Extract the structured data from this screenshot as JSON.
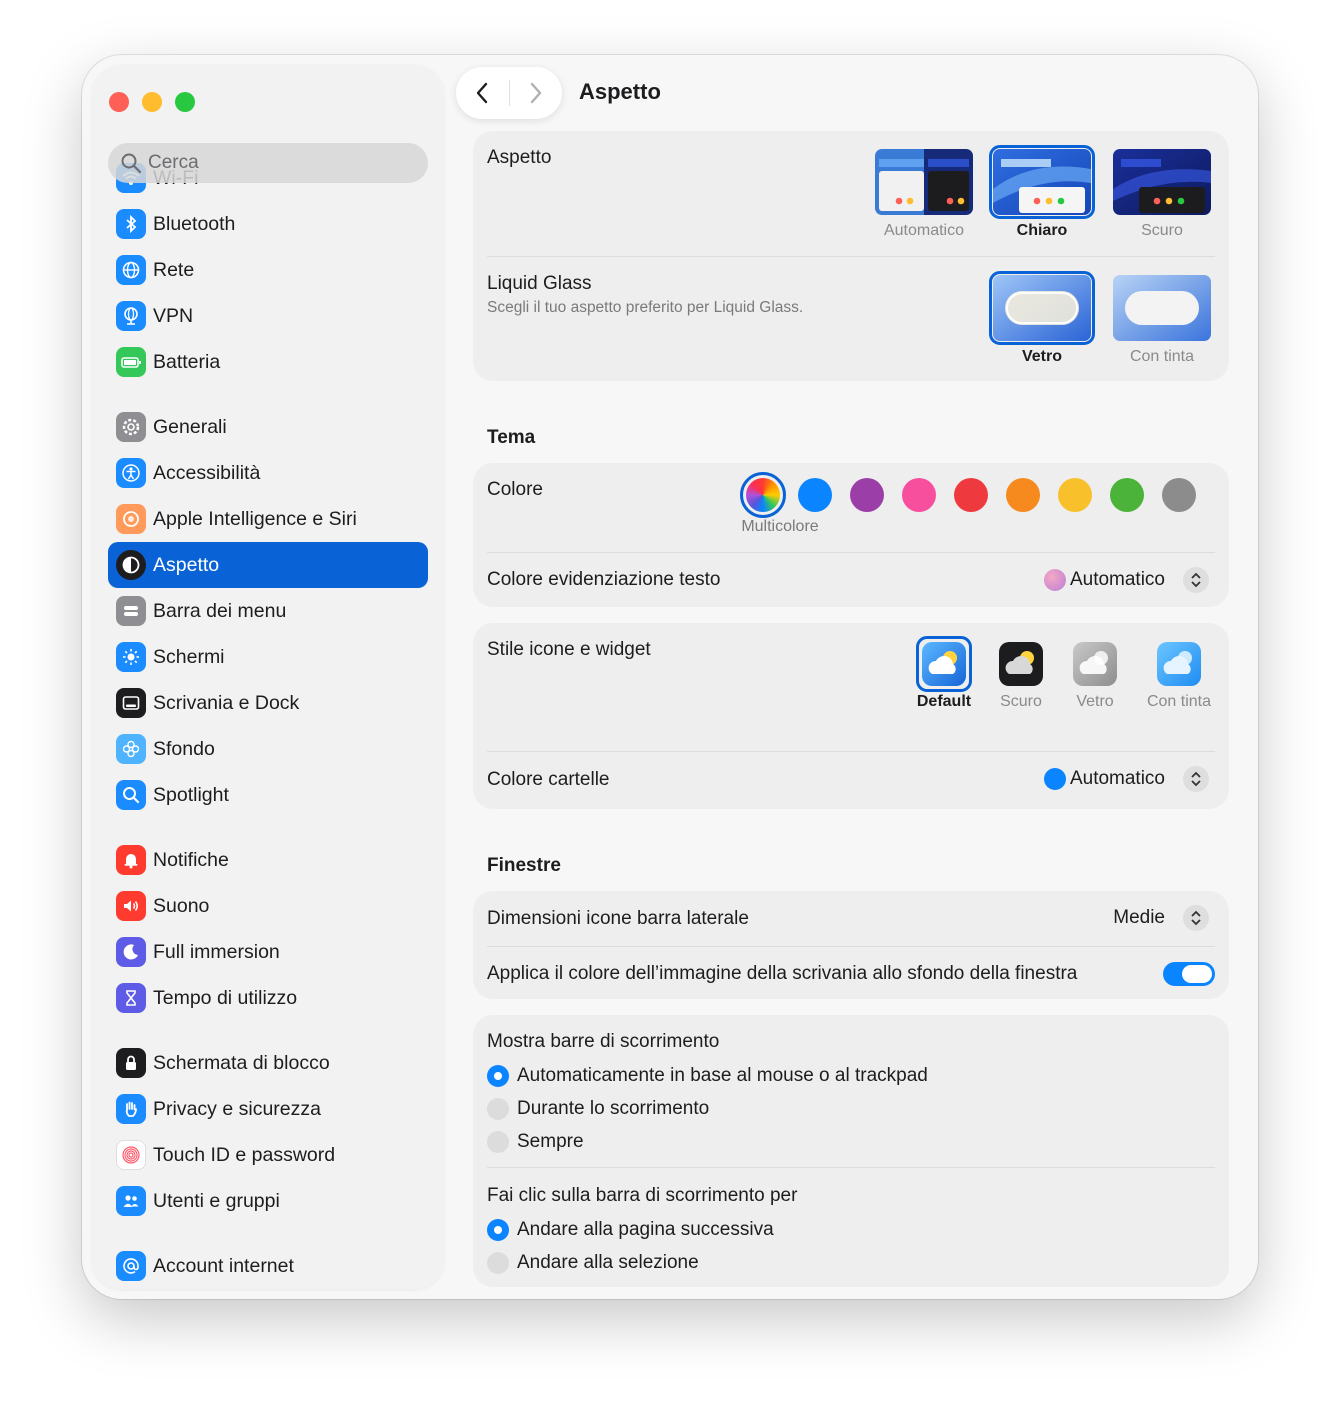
{
  "sidebar": {
    "search_placeholder": "Cerca",
    "groups": [
      [
        {
          "label": "Wi-Fi",
          "icon": "wifi-icon",
          "color": "#1a8cff"
        },
        {
          "label": "Bluetooth",
          "icon": "bluetooth-icon",
          "color": "#1a8cff"
        },
        {
          "label": "Rete",
          "icon": "globe-icon",
          "color": "#1a8cff"
        },
        {
          "label": "VPN",
          "icon": "vpn-globe-icon",
          "color": "#1a8cff"
        },
        {
          "label": "Batteria",
          "icon": "battery-icon",
          "color": "#34c759"
        }
      ],
      [
        {
          "label": "Generali",
          "icon": "gear-icon",
          "color": "#8e8e93"
        },
        {
          "label": "Accessibilità",
          "icon": "accessibility-icon",
          "color": "#1a8cff"
        },
        {
          "label": "Apple Intelligence e Siri",
          "icon": "siri-icon",
          "color": "#ff9a5a"
        },
        {
          "label": "Aspetto",
          "icon": "appearance-icon",
          "color": "#1d1d1f",
          "active": true
        },
        {
          "label": "Barra dei menu",
          "icon": "menubar-icon",
          "color": "#8e8e93"
        },
        {
          "label": "Schermi",
          "icon": "brightness-icon",
          "color": "#1a8cff"
        },
        {
          "label": "Scrivania e Dock",
          "icon": "dock-icon",
          "color": "#1d1d1f"
        },
        {
          "label": "Sfondo",
          "icon": "wallpaper-icon",
          "color": "#4fb3ff"
        },
        {
          "label": "Spotlight",
          "icon": "spotlight-icon",
          "color": "#1a8cff"
        }
      ],
      [
        {
          "label": "Notifiche",
          "icon": "bell-icon",
          "color": "#ff3b30"
        },
        {
          "label": "Suono",
          "icon": "speaker-icon",
          "color": "#ff3b30"
        },
        {
          "label": "Full immersion",
          "icon": "moon-icon",
          "color": "#5e5ce6"
        },
        {
          "label": "Tempo di utilizzo",
          "icon": "hourglass-icon",
          "color": "#5e5ce6"
        }
      ],
      [
        {
          "label": "Schermata di blocco",
          "icon": "lock-icon",
          "color": "#1d1d1f"
        },
        {
          "label": "Privacy e sicurezza",
          "icon": "hand-icon",
          "color": "#1a8cff"
        },
        {
          "label": "Touch ID e password",
          "icon": "fingerprint-icon",
          "color": "#ffffff"
        },
        {
          "label": "Utenti e gruppi",
          "icon": "users-icon",
          "color": "#1a8cff"
        }
      ],
      [
        {
          "label": "Account internet",
          "icon": "at-icon",
          "color": "#1a8cff"
        }
      ]
    ]
  },
  "toolbar": {
    "title": "Aspetto"
  },
  "appearance": {
    "label": "Aspetto",
    "options": [
      "Automatico",
      "Chiaro",
      "Scuro"
    ],
    "selected": "Chiaro"
  },
  "liquid_glass": {
    "label": "Liquid Glass",
    "description": "Scegli il tuo aspetto preferito per Liquid Glass.",
    "options": [
      "Vetro",
      "Con tinta"
    ],
    "selected": "Vetro"
  },
  "tema": {
    "title": "Tema",
    "color_label": "Colore",
    "selected_color_caption": "Multicolore",
    "colors": [
      "multicolor",
      "#0a84ff",
      "#9b3ea8",
      "#f74f9e",
      "#ee3a3f",
      "#f78a1f",
      "#f8c12c",
      "#4bb33a",
      "#8c8c8c"
    ],
    "highlight_label": "Colore evidenziazione testo",
    "highlight_value": "Automatico",
    "icon_style_label": "Stile icone e widget",
    "icon_styles": [
      "Default",
      "Scuro",
      "Vetro",
      "Con tinta"
    ],
    "icon_style_selected": "Default",
    "folder_color_label": "Colore cartelle",
    "folder_color_value": "Automatico"
  },
  "finestre": {
    "title": "Finestre",
    "sidebar_icon_size_label": "Dimensioni icone barra laterale",
    "sidebar_icon_size_value": "Medie",
    "wallpaper_tint_label": "Applica il colore dell’immagine della scrivania allo sfondo della finestra",
    "wallpaper_tint_on": true
  },
  "scroll": {
    "show_label": "Mostra barre di scorrimento",
    "show_options": [
      "Automaticamente in base al mouse o al trackpad",
      "Durante lo scorrimento",
      "Sempre"
    ],
    "show_selected": 0,
    "click_label": "Fai clic sulla barra di scorrimento per",
    "click_options": [
      "Andare alla pagina successiva",
      "Andare alla selezione"
    ],
    "click_selected": 0
  }
}
